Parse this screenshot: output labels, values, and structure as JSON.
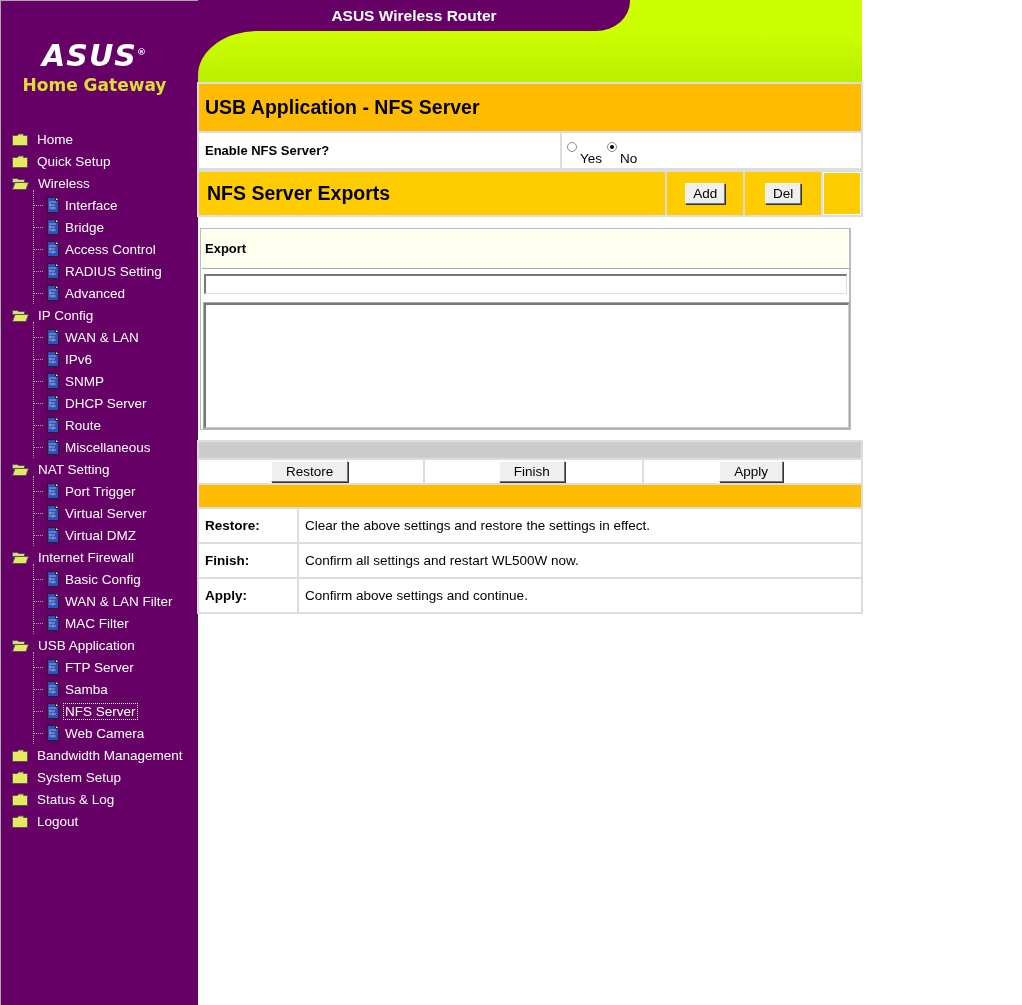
{
  "header": {
    "title": "ASUS Wireless Router"
  },
  "logo": {
    "brand": "ASUS$^{®}$",
    "subtitle": "Home Gateway"
  },
  "sidebar": {
    "items": [
      {
        "label": "Home",
        "kind": "folder",
        "expanded": false,
        "selected": false
      },
      {
        "label": "Quick Setup",
        "kind": "folder",
        "expanded": false,
        "selected": false
      },
      {
        "label": "Wireless",
        "kind": "folder",
        "expanded": true,
        "selected": false,
        "children": [
          {
            "label": "Interface",
            "kind": "page",
            "selected": false
          },
          {
            "label": "Bridge",
            "kind": "page",
            "selected": false
          },
          {
            "label": "Access Control",
            "kind": "page",
            "selected": false
          },
          {
            "label": "RADIUS Setting",
            "kind": "page",
            "selected": false
          },
          {
            "label": "Advanced",
            "kind": "page",
            "selected": false
          }
        ]
      },
      {
        "label": "IP Config",
        "kind": "folder",
        "expanded": true,
        "selected": false,
        "children": [
          {
            "label": "WAN & LAN",
            "kind": "page",
            "selected": false
          },
          {
            "label": "IPv6",
            "kind": "page",
            "selected": false
          },
          {
            "label": "SNMP",
            "kind": "page",
            "selected": false
          },
          {
            "label": "DHCP Server",
            "kind": "page",
            "selected": false
          },
          {
            "label": "Route",
            "kind": "page",
            "selected": false
          },
          {
            "label": "Miscellaneous",
            "kind": "page",
            "selected": false
          }
        ]
      },
      {
        "label": "NAT Setting",
        "kind": "folder",
        "expanded": true,
        "selected": false,
        "children": [
          {
            "label": "Port Trigger",
            "kind": "page",
            "selected": false
          },
          {
            "label": "Virtual Server",
            "kind": "page",
            "selected": false
          },
          {
            "label": "Virtual DMZ",
            "kind": "page",
            "selected": false
          }
        ]
      },
      {
        "label": "Internet Firewall",
        "kind": "folder",
        "expanded": true,
        "selected": false,
        "children": [
          {
            "label": "Basic Config",
            "kind": "page",
            "selected": false
          },
          {
            "label": "WAN & LAN Filter",
            "kind": "page",
            "selected": false
          },
          {
            "label": "MAC Filter",
            "kind": "page",
            "selected": false
          }
        ]
      },
      {
        "label": "USB Application",
        "kind": "folder",
        "expanded": true,
        "selected": false,
        "children": [
          {
            "label": "FTP Server",
            "kind": "page",
            "selected": false
          },
          {
            "label": "Samba",
            "kind": "page",
            "selected": false
          },
          {
            "label": "NFS Server",
            "kind": "page",
            "selected": true
          },
          {
            "label": "Web Camera",
            "kind": "page",
            "selected": false
          }
        ]
      },
      {
        "label": "Bandwidth Management",
        "kind": "folder",
        "expanded": false,
        "selected": false
      },
      {
        "label": "System Setup",
        "kind": "folder",
        "expanded": false,
        "selected": false
      },
      {
        "label": "Status & Log",
        "kind": "folder",
        "expanded": false,
        "selected": false
      },
      {
        "label": "Logout",
        "kind": "folder",
        "expanded": false,
        "selected": false
      }
    ]
  },
  "page_title": "USB Application - NFS Server",
  "enable_nfs": {
    "label": "Enable NFS Server?",
    "options": [
      {
        "label": "Yes",
        "selected": false
      },
      {
        "label": "No",
        "selected": true
      }
    ]
  },
  "exports": {
    "title": "NFS Server Exports",
    "buttons": [
      "Add",
      "Del"
    ],
    "table": {
      "columns": [
        "Export"
      ]
    }
  },
  "actions": [
    "Restore",
    "Finish",
    "Apply"
  ],
  "help": [
    {
      "term": "Restore:",
      "description": "Clear the above settings and restore the settings in effect."
    },
    {
      "term": "Finish:",
      "description": "Confirm all settings and restart WL500W now."
    },
    {
      "term": "Apply:",
      "description": "Confirm above settings and continue."
    }
  ]
}
